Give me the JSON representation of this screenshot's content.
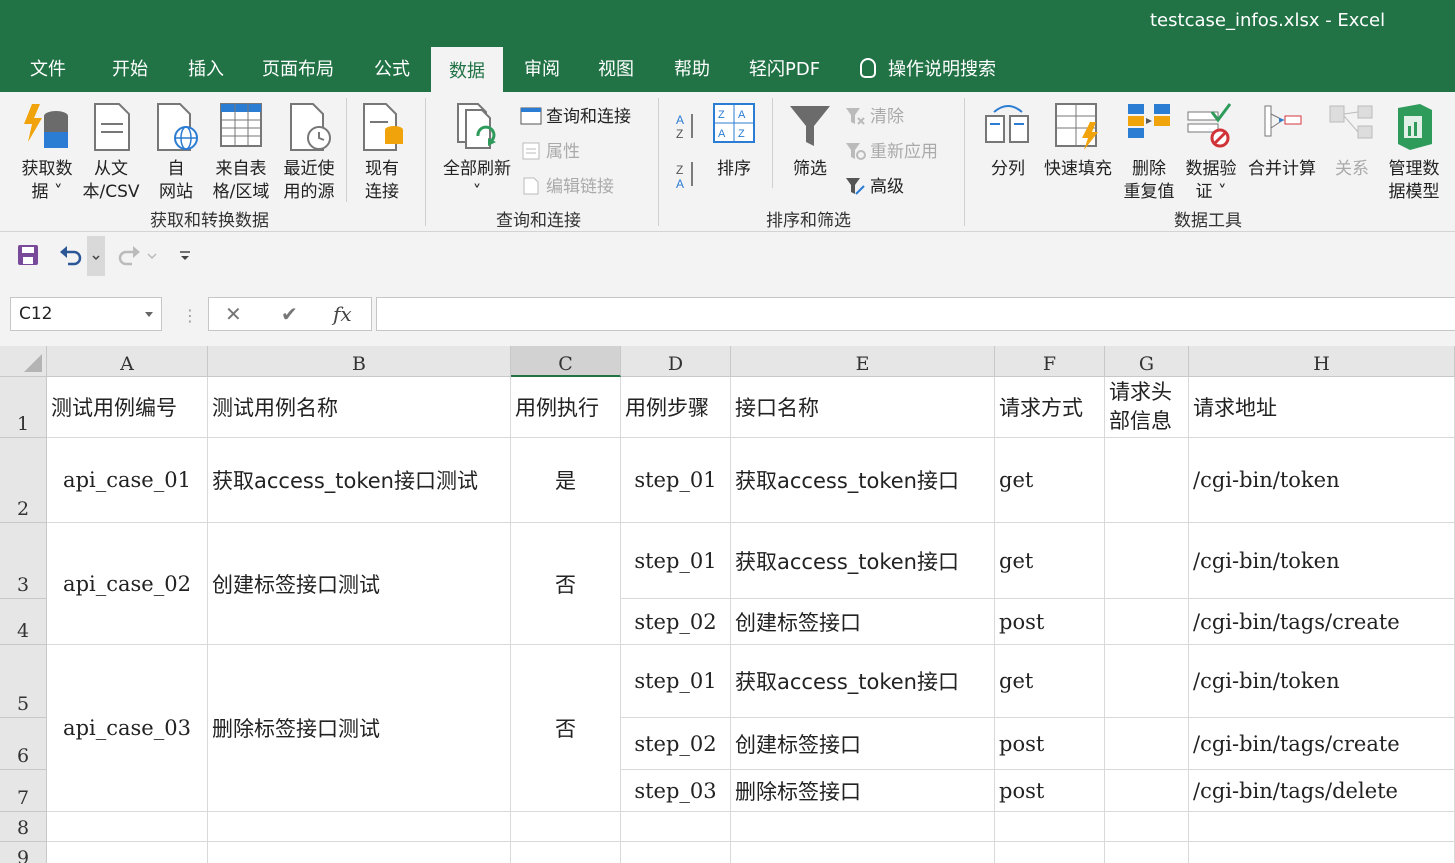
{
  "window": {
    "title": "testcase_infos.xlsx  -  Excel"
  },
  "tabs": [
    "文件",
    "开始",
    "插入",
    "页面布局",
    "公式",
    "数据",
    "审阅",
    "视图",
    "帮助",
    "轻闪PDF"
  ],
  "active_tab": "数据",
  "tell_me": "操作说明搜索",
  "ribbon": {
    "get_data": "获取数\n据 ˅",
    "from_csv": "从文\n本/CSV",
    "from_web": "自\n网站",
    "from_table": "来自表\n格/区域",
    "recent_sources": "最近使\n用的源",
    "existing_connections": "现有\n连接",
    "group_get_transform": "获取和转换数据",
    "refresh_all": "全部刷新\n˅",
    "queries_connections": "查询和连接",
    "properties": "属性",
    "edit_links": "编辑链接",
    "group_queries": "查询和连接",
    "sort": "排序",
    "filter": "筛选",
    "clear": "清除",
    "reapply": "重新应用",
    "advanced": "高级",
    "group_sort_filter": "排序和筛选",
    "text_to_columns": "分列",
    "flash_fill": "快速填充",
    "remove_duplicates": "删除\n重复值",
    "data_validation": "数据验\n证 ˅",
    "consolidate": "合并计算",
    "relationships": "关系",
    "manage_data_model": "管理数\n据模型",
    "group_data_tools": "数据工具"
  },
  "formula_bar": {
    "name_box": "C12",
    "cancel": "✕",
    "enter": "✔",
    "fx": "fx",
    "value": ""
  },
  "columns": [
    "A",
    "B",
    "C",
    "D",
    "E",
    "F",
    "G",
    "H"
  ],
  "rows": [
    "1",
    "2",
    "3",
    "4",
    "5",
    "6",
    "7",
    "8",
    "9"
  ],
  "header": {
    "a": "测试用例编号",
    "b": "测试用例名称",
    "c": "用例执行",
    "d": "用例步骤",
    "e": "接口名称",
    "f": "请求方式",
    "g": "请求头部信息",
    "h": "请求地址"
  },
  "cases": [
    {
      "id": "api_case_01",
      "name": "获取access_token接口测试",
      "run": "是"
    },
    {
      "id": "api_case_02",
      "name": "创建标签接口测试",
      "run": "否"
    },
    {
      "id": "api_case_03",
      "name": "删除标签接口测试",
      "run": "否"
    }
  ],
  "steps": [
    {
      "step": "step_01",
      "api": "获取access_token接口",
      "method": "get",
      "url": "/cgi-bin/token"
    },
    {
      "step": "step_01",
      "api": "获取access_token接口",
      "method": "get",
      "url": "/cgi-bin/token"
    },
    {
      "step": "step_02",
      "api": "创建标签接口",
      "method": "post",
      "url": "/cgi-bin/tags/create"
    },
    {
      "step": "step_01",
      "api": "获取access_token接口",
      "method": "get",
      "url": "/cgi-bin/token"
    },
    {
      "step": "step_02",
      "api": "创建标签接口",
      "method": "post",
      "url": "/cgi-bin/tags/create"
    },
    {
      "step": "step_03",
      "api": "删除标签接口",
      "method": "post",
      "url": "/cgi-bin/tags/delete"
    }
  ]
}
